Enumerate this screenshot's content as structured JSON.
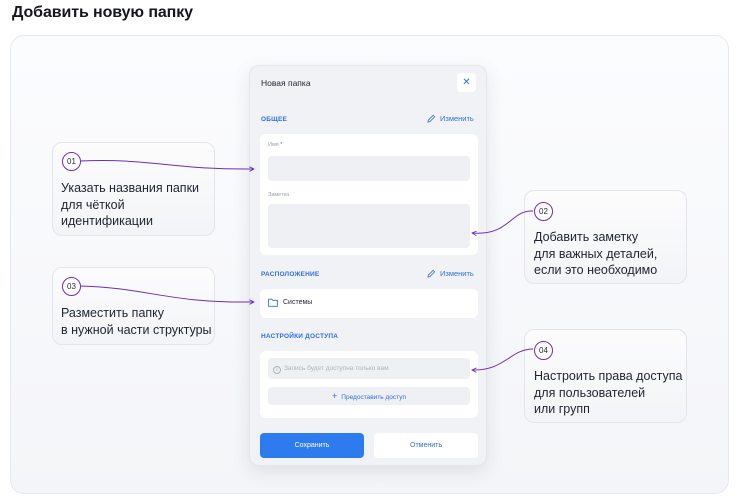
{
  "page": {
    "title": "Добавить новую папку"
  },
  "callouts": [
    {
      "number": "01",
      "text": "Указать названия папки\nдля чёткой\nидентификации"
    },
    {
      "number": "02",
      "text": "Добавить заметку\nдля важных деталей,\nесли это необходимо"
    },
    {
      "number": "03",
      "text": "Разместить папку\nв нужной части структуры"
    },
    {
      "number": "04",
      "text": "Настроить права доступа\nдля пользователей\nили групп"
    }
  ],
  "modal": {
    "title": "Новая папка",
    "close_label": "✕",
    "general": {
      "section_label": "ОБЩЕЕ",
      "edit_label": "Изменить",
      "name_label": "Имя",
      "required_mark": "*",
      "note_label": "Заметка"
    },
    "location": {
      "section_label": "РАСПОЛОЖЕНИЕ",
      "edit_label": "Изменить",
      "folder_name": "Системы"
    },
    "access": {
      "section_label": "НАСТРОЙКИ ДОСТУПА",
      "info_text": "Запись будет доступна только вам",
      "grant_label": "Предоставить доступ"
    },
    "save_label": "Сохранить",
    "cancel_label": "Отменить"
  },
  "colors": {
    "accent": "#2e6fe0",
    "primary_button": "#2e7bf0",
    "connector": "#6b2fb8"
  }
}
